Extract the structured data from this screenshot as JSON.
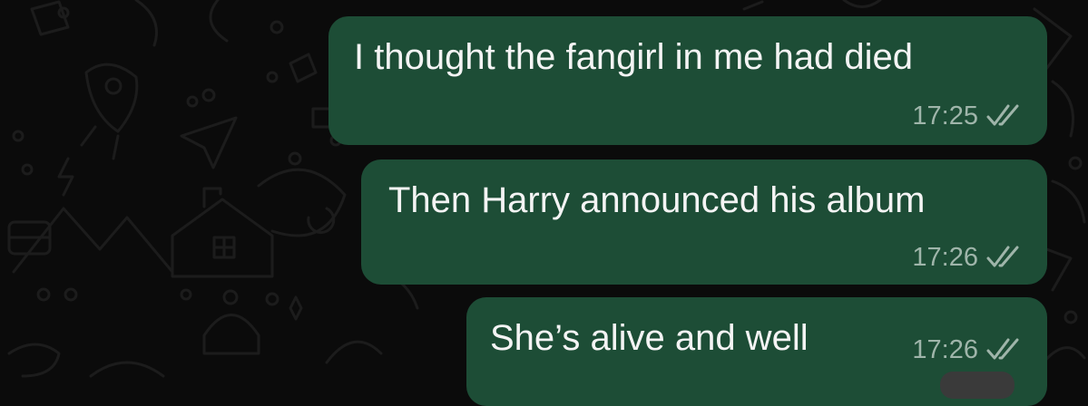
{
  "chat": {
    "messages": [
      {
        "text": "I thought the fangirl in me had died",
        "time": "17:25",
        "status_icon": "double-check-icon"
      },
      {
        "text": "Then Harry announced his album",
        "time": "17:26",
        "status_icon": "double-check-icon"
      },
      {
        "text": "She’s alive and well",
        "time": "17:26",
        "status_icon": "double-check-icon"
      }
    ]
  },
  "colors": {
    "bubble_outgoing": "#1d4d36",
    "background": "#0b0b0b",
    "meta_text": "#9fb5aa"
  }
}
